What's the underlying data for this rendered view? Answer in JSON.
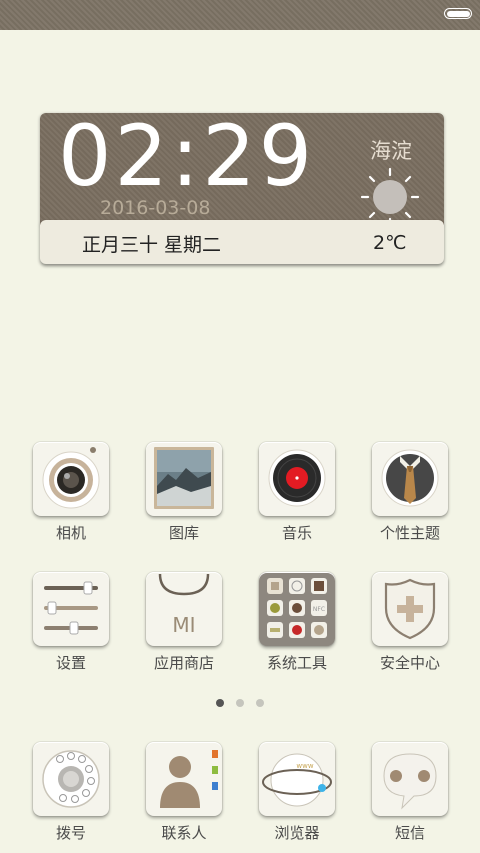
{
  "status_bar": {
    "battery": "full"
  },
  "clock": {
    "time": "02:29",
    "date": "2016-03-08",
    "city": "海淀",
    "lunar_weekday": "正月三十   星期二",
    "temperature": "2℃"
  },
  "apps_row1": [
    {
      "label": "相机",
      "icon": "camera-icon"
    },
    {
      "label": "图库",
      "icon": "gallery-icon"
    },
    {
      "label": "音乐",
      "icon": "music-icon"
    },
    {
      "label": "个性主题",
      "icon": "theme-icon"
    }
  ],
  "apps_row2": [
    {
      "label": "设置",
      "icon": "settings-icon"
    },
    {
      "label": "应用商店",
      "icon": "app-store-icon"
    },
    {
      "label": "系统工具",
      "icon": "system-tools-icon"
    },
    {
      "label": "安全中心",
      "icon": "security-center-icon"
    }
  ],
  "dock": [
    {
      "label": "拨号",
      "icon": "phone-dial-icon"
    },
    {
      "label": "联系人",
      "icon": "contacts-icon"
    },
    {
      "label": "浏览器",
      "icon": "browser-icon"
    },
    {
      "label": "短信",
      "icon": "sms-icon"
    }
  ],
  "app_store_logo_text": "MI",
  "browser_icon_text": "www",
  "page_indicator": {
    "count": 3,
    "active": 1
  }
}
